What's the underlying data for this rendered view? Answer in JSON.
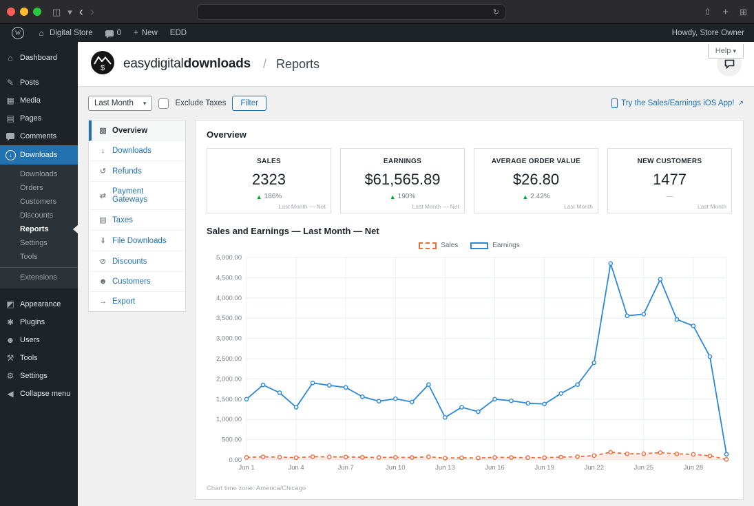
{
  "browser": {
    "back_icon": "‹",
    "forward_icon": "›",
    "reload_icon": "↻",
    "sidebar_toggle_icon": "◫",
    "chevron_icon": "▾",
    "share_icon": "⇧",
    "new_tab_icon": "+",
    "tab_overview_icon": "⊞"
  },
  "admin_bar": {
    "wp_logo": "W",
    "home_icon": "⌂",
    "site_name": "Digital Store",
    "comments_count": "0",
    "new_icon": "+",
    "new_label": "New",
    "edd_label": "EDD",
    "howdy": "Howdy, Store Owner"
  },
  "sidebar": {
    "items": [
      {
        "label": "Dashboard",
        "icon": "⌂"
      },
      {
        "label": "Posts",
        "icon": "✎"
      },
      {
        "label": "Media",
        "icon": "▦"
      },
      {
        "label": "Pages",
        "icon": "▤"
      },
      {
        "label": "Comments",
        "icon": "speech-bubble"
      },
      {
        "label": "Downloads",
        "icon": "↓"
      },
      {
        "label": "Appearance",
        "icon": "◩"
      },
      {
        "label": "Plugins",
        "icon": "✱"
      },
      {
        "label": "Users",
        "icon": "☻"
      },
      {
        "label": "Tools",
        "icon": "⚒"
      },
      {
        "label": "Settings",
        "icon": "⚙"
      },
      {
        "label": "Collapse menu",
        "icon": "◀"
      }
    ],
    "downloads_submenu": [
      "Downloads",
      "Orders",
      "Customers",
      "Discounts",
      "Reports",
      "Settings",
      "Tools",
      "Extensions"
    ]
  },
  "header": {
    "brand_light": "easydigital",
    "brand_bold": "downloads",
    "separator": "/",
    "page": "Reports",
    "help_label": "Help",
    "help_caret": "▾"
  },
  "filters": {
    "period_value": "Last Month",
    "period_caret": "▾",
    "exclude_taxes_label": "Exclude Taxes",
    "filter_button": "Filter",
    "ios_app_link": "Try the Sales/Earnings iOS App!",
    "external_icon": "↗"
  },
  "report_tabs": [
    {
      "label": "Overview",
      "icon": "▧",
      "active": true
    },
    {
      "label": "Downloads",
      "icon": "↓"
    },
    {
      "label": "Refunds",
      "icon": "↺"
    },
    {
      "label": "Payment Gateways",
      "icon": "⇄"
    },
    {
      "label": "Taxes",
      "icon": "▤"
    },
    {
      "label": "File Downloads",
      "icon": "⇓"
    },
    {
      "label": "Discounts",
      "icon": "⊘"
    },
    {
      "label": "Customers",
      "icon": "☻"
    },
    {
      "label": "Export",
      "icon": "→"
    }
  ],
  "icons": {
    "up_triangle": "▲"
  },
  "overview": {
    "title": "Overview",
    "cards": [
      {
        "label": "SALES",
        "value": "2323",
        "delta": "186%",
        "delta_dir": "up",
        "footnote": "Last Month — Net"
      },
      {
        "label": "EARNINGS",
        "value": "$61,565.89",
        "delta": "190%",
        "delta_dir": "up",
        "footnote": "Last Month — Net"
      },
      {
        "label": "AVERAGE ORDER VALUE",
        "value": "$26.80",
        "delta": "2.42%",
        "delta_dir": "up",
        "footnote": "Last Month"
      },
      {
        "label": "NEW CUSTOMERS",
        "value": "1477",
        "delta": "—",
        "delta_dir": "none",
        "footnote": "Last Month"
      }
    ]
  },
  "chart_section": {
    "title": "Sales and Earnings — Last Month — Net",
    "timezone_note": "Chart time zone: America/Chicago"
  },
  "chart_data": {
    "type": "line",
    "title": "Sales and Earnings — Last Month — Net",
    "legend_position": "top",
    "grid": true,
    "x": [
      "Jun 1",
      "Jun 2",
      "Jun 3",
      "Jun 4",
      "Jun 5",
      "Jun 6",
      "Jun 7",
      "Jun 8",
      "Jun 9",
      "Jun 10",
      "Jun 11",
      "Jun 12",
      "Jun 13",
      "Jun 14",
      "Jun 15",
      "Jun 16",
      "Jun 17",
      "Jun 18",
      "Jun 19",
      "Jun 20",
      "Jun 21",
      "Jun 22",
      "Jun 23",
      "Jun 24",
      "Jun 25",
      "Jun 26",
      "Jun 27",
      "Jun 28",
      "Jun 29",
      "Jun 30"
    ],
    "x_tick_every": 3,
    "x_tick_labels": [
      "Jun 1",
      "Jun 4",
      "Jun 7",
      "Jun 10",
      "Jun 13",
      "Jun 16",
      "Jun 19",
      "Jun 22",
      "Jun 25",
      "Jun 28"
    ],
    "ylim": [
      0,
      5000
    ],
    "y_tick_step": 500,
    "y_tick_labels": [
      "0.00",
      "500.00",
      "1,000.00",
      "1,500.00",
      "2,000.00",
      "2,500.00",
      "3,000.00",
      "3,500.00",
      "4,000.00",
      "4,500.00",
      "5,000.00"
    ],
    "series": [
      {
        "name": "Sales",
        "color": "#ef6a3d",
        "style": "dashed",
        "fill": "rgba(239,106,61,0.12)",
        "values": [
          62,
          75,
          68,
          55,
          78,
          74,
          72,
          64,
          60,
          63,
          58,
          76,
          42,
          52,
          48,
          61,
          59,
          56,
          55,
          68,
          78,
          105,
          190,
          150,
          152,
          180,
          148,
          138,
          100,
          12
        ]
      },
      {
        "name": "Earnings",
        "color": "#2b87d8",
        "style": "solid",
        "values": [
          1500,
          1850,
          1660,
          1300,
          1900,
          1840,
          1790,
          1560,
          1450,
          1510,
          1430,
          1860,
          1050,
          1300,
          1190,
          1500,
          1460,
          1400,
          1380,
          1640,
          1860,
          2400,
          4850,
          3560,
          3600,
          4460,
          3470,
          3310,
          2550,
          140
        ]
      }
    ]
  }
}
